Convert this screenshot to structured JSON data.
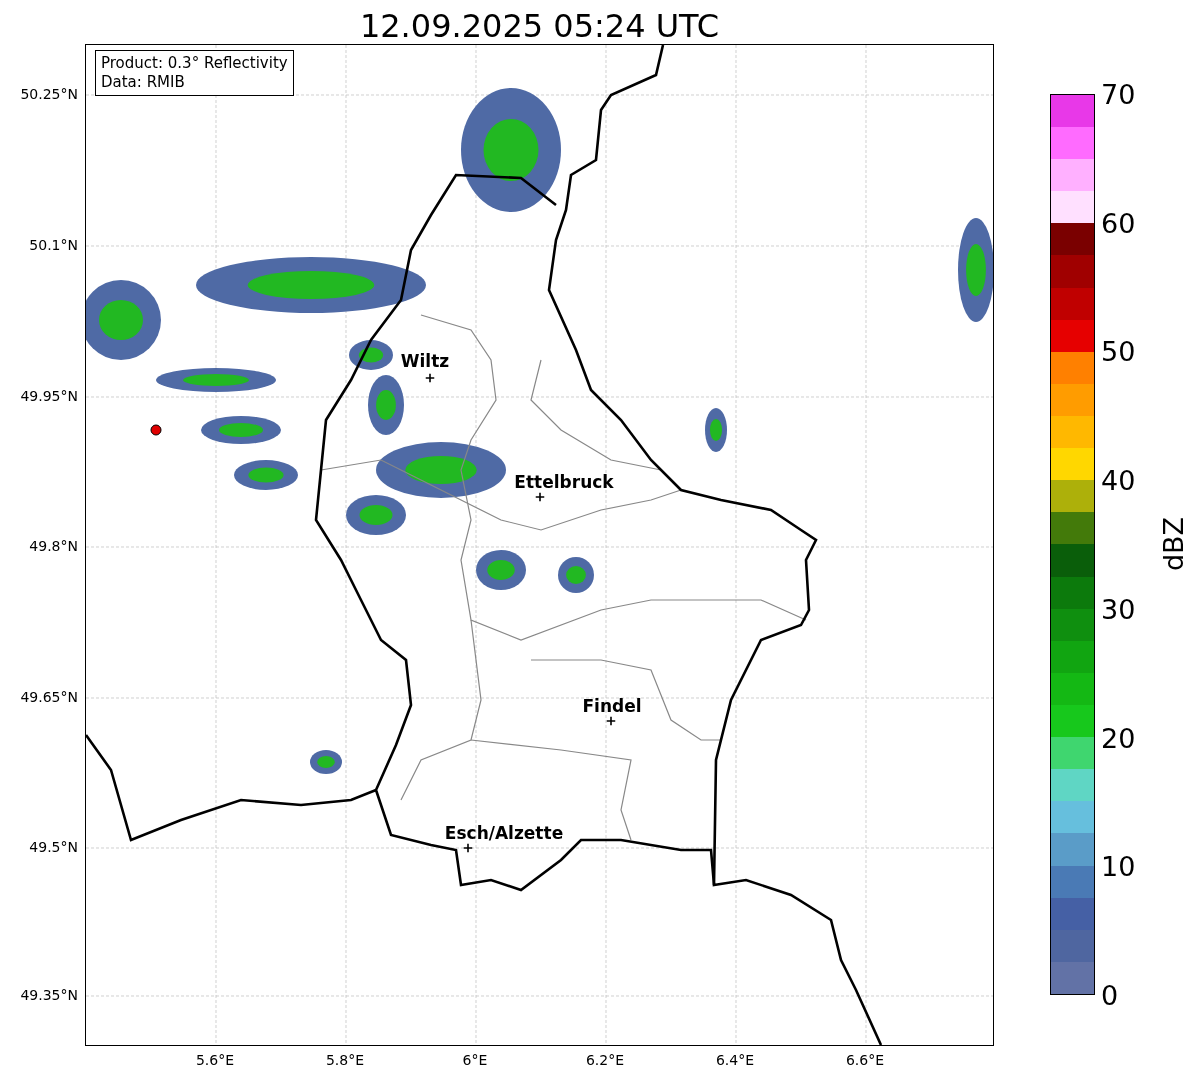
{
  "title": "12.09.2025 05:24 UTC",
  "info_box": [
    "Product: 0.3° Reflectivity",
    "Data: RMIB"
  ],
  "map": {
    "cities": [
      {
        "name": "Wiltz"
      },
      {
        "name": "Ettelbruck"
      },
      {
        "name": "Findel"
      },
      {
        "name": "Esch/Alzette"
      }
    ]
  },
  "lat_ticks": [
    "50.25°N",
    "50.1°N",
    "49.95°N",
    "49.8°N",
    "49.65°N",
    "49.5°N",
    "49.35°N"
  ],
  "lon_ticks": [
    "5.6°E",
    "5.8°E",
    "6°E",
    "6.2°E",
    "6.4°E",
    "6.6°E"
  ],
  "colorbar": {
    "label": "dBZ",
    "ticks": [
      "70",
      "60",
      "50",
      "40",
      "30",
      "20",
      "10",
      "0"
    ]
  }
}
